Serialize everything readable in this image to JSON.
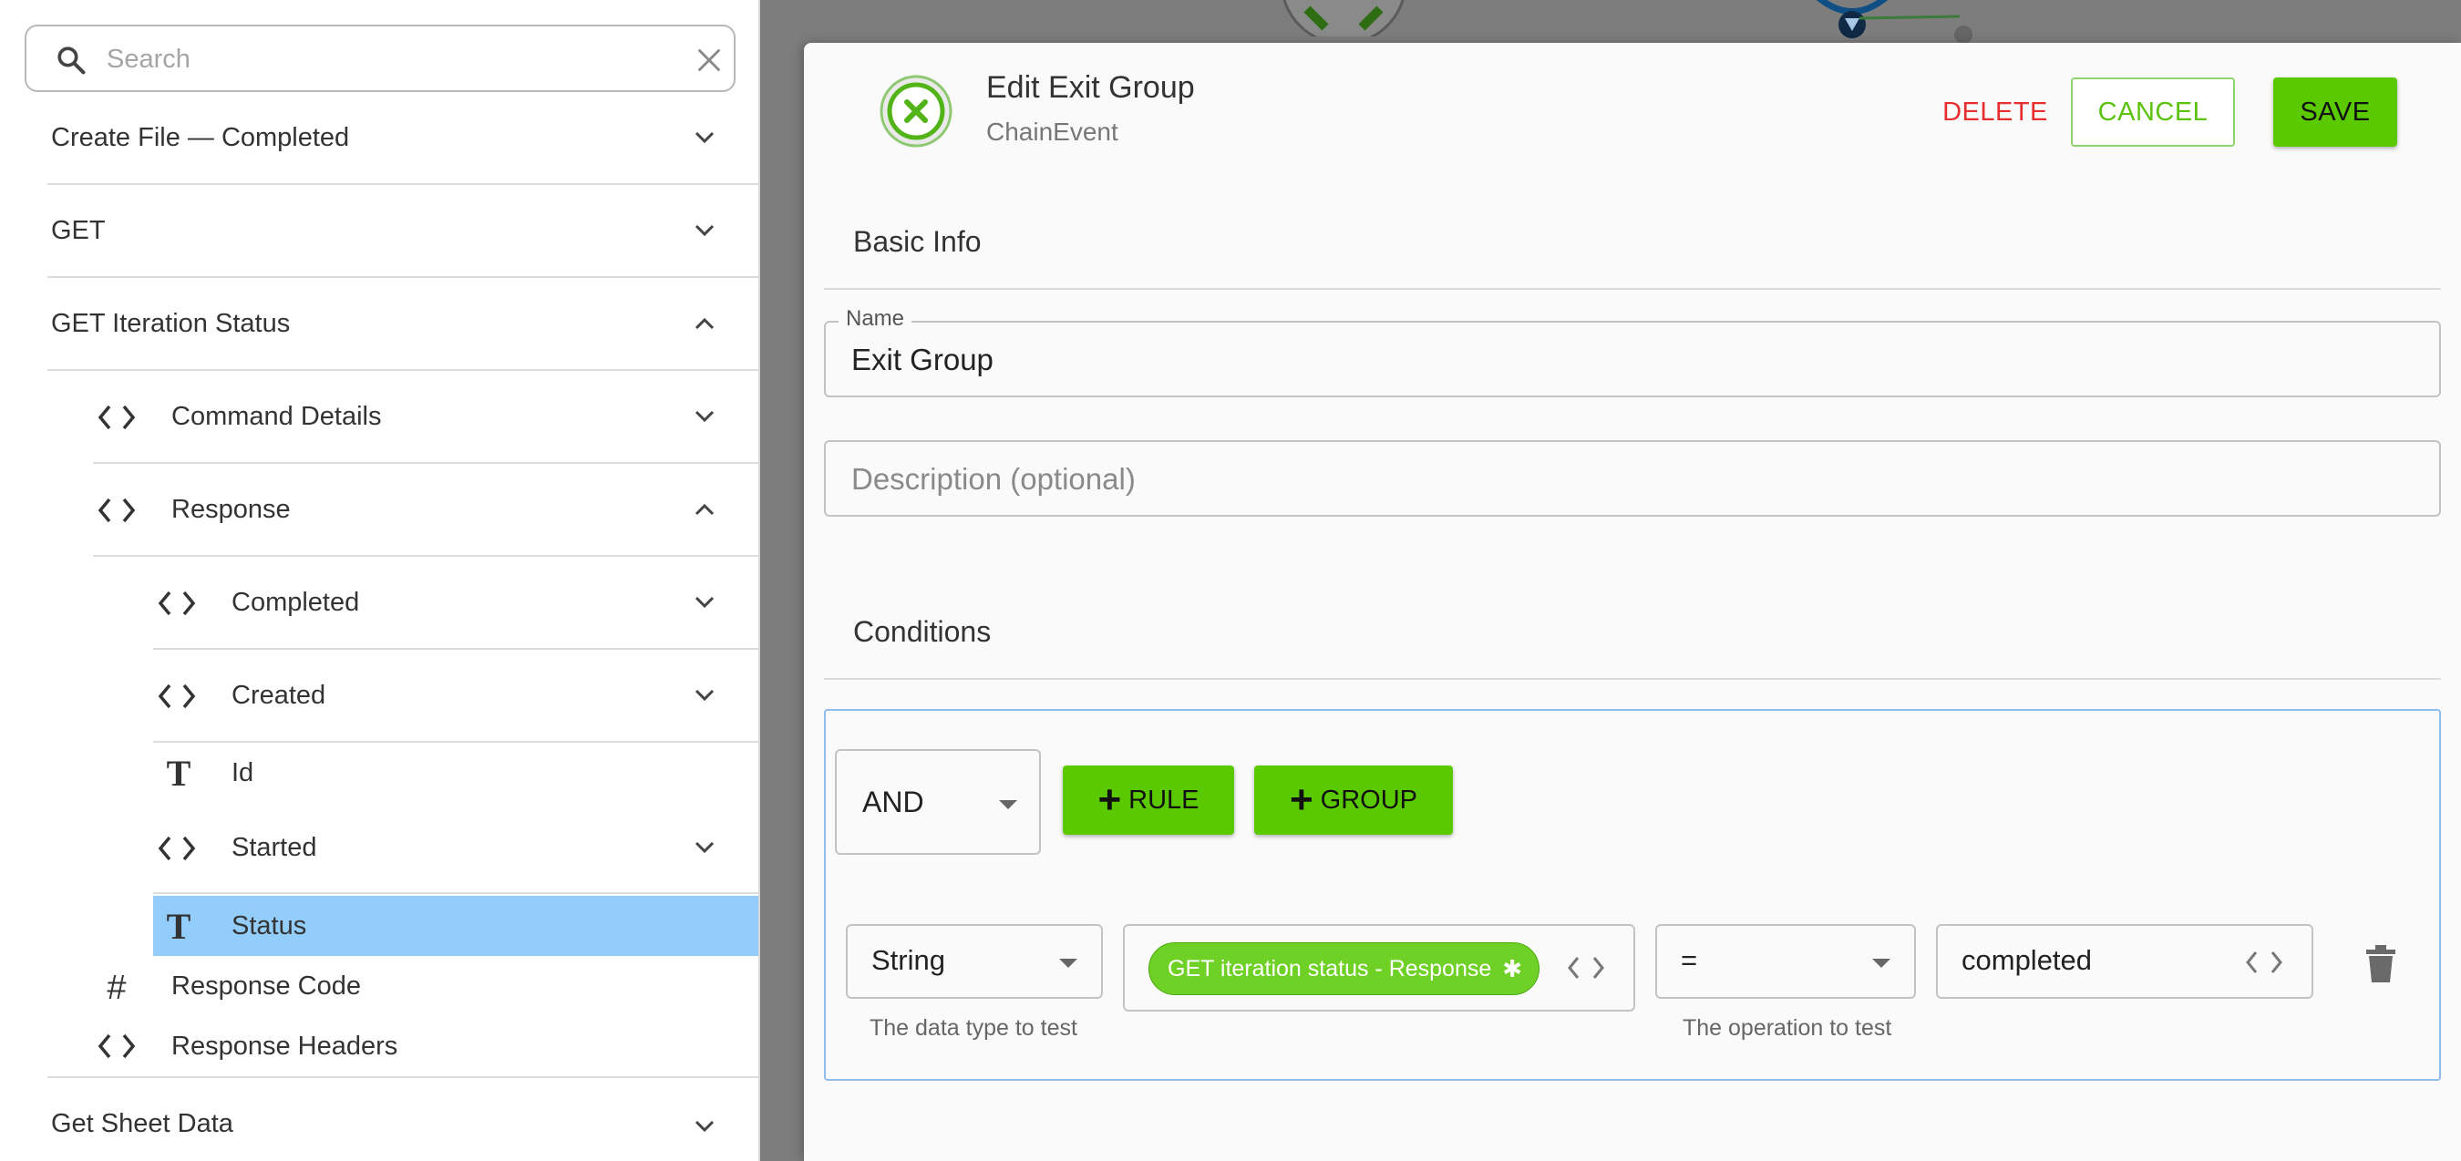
{
  "sidebar": {
    "search_placeholder": "Search",
    "items": [
      {
        "label": "Create File — Completed",
        "icon": "",
        "expanded": false
      },
      {
        "label": "GET",
        "icon": "",
        "expanded": false
      },
      {
        "label": "GET Iteration Status",
        "icon": "",
        "expanded": true
      },
      {
        "label": "Command Details",
        "icon": "code-brackets-icon",
        "expanded": false
      },
      {
        "label": "Response",
        "icon": "code-brackets-icon",
        "expanded": true
      },
      {
        "label": "Completed",
        "icon": "code-brackets-icon",
        "expanded": false
      },
      {
        "label": "Created",
        "icon": "code-brackets-icon",
        "expanded": false
      },
      {
        "label": "Id",
        "icon": "text-type-icon"
      },
      {
        "label": "Started",
        "icon": "code-brackets-icon",
        "expanded": false
      },
      {
        "label": "Status",
        "icon": "text-type-icon",
        "selected": true
      },
      {
        "label": "Response Code",
        "icon": "number-hash-icon"
      },
      {
        "label": "Response Headers",
        "icon": "code-brackets-icon"
      },
      {
        "label": "Get Sheet Data",
        "icon": "",
        "expanded": false
      }
    ]
  },
  "dialog": {
    "title": "Edit Exit Group",
    "subtitle": "ChainEvent",
    "icon": "circle-x-icon",
    "delete_label": "DELETE",
    "cancel_label": "CANCEL",
    "save_label": "SAVE",
    "basic_info": {
      "heading": "Basic Info",
      "name_label": "Name",
      "name_value": "Exit Group",
      "description_placeholder": "Description (optional)",
      "description_value": ""
    },
    "conditions": {
      "heading": "Conditions",
      "combinator": "AND",
      "add_rule_label": "RULE",
      "add_group_label": "GROUP",
      "rule": {
        "data_type": "String",
        "data_type_helper": "The data type to test",
        "source_chip": "GET iteration status - Response",
        "operator": "=",
        "operator_helper": "The operation to test",
        "value": "completed"
      }
    }
  },
  "colors": {
    "accent_green": "#5bc900",
    "danger_red": "#e62e2e",
    "selected_row": "#92cdfb"
  }
}
